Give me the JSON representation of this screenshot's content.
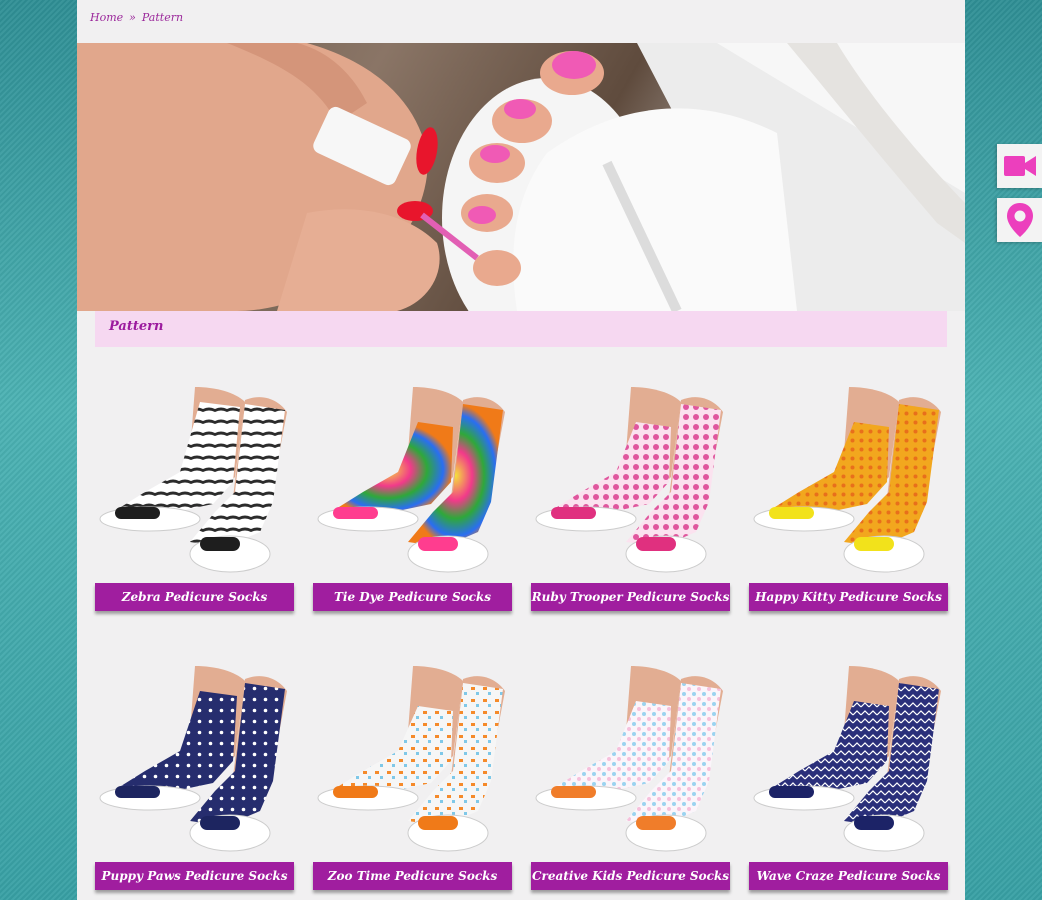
{
  "breadcrumb": {
    "home": "Home",
    "separator": "»",
    "current": "Pattern"
  },
  "section": {
    "title": "Pattern"
  },
  "products": [
    {
      "name": "Zebra Pedicure Socks",
      "color1": "#2b2b2b",
      "color2": "#ffffff",
      "toe": "#1e1e1e"
    },
    {
      "name": "Tie Dye Pedicure Socks",
      "color1": "#2fa83a",
      "color2": "#f23a8a",
      "toe": "#ff3d8f"
    },
    {
      "name": "Ruby Trooper Pedicure Socks",
      "color1": "#e0569e",
      "color2": "#fbe2ef",
      "toe": "#e0307f"
    },
    {
      "name": "Happy Kitty Pedicure Socks",
      "color1": "#f2a71e",
      "color2": "#e86f1b",
      "toe": "#f2e21b"
    },
    {
      "name": "Puppy Paws Pedicure Socks",
      "color1": "#262d6e",
      "color2": "#ffffff",
      "toe": "#1d2560"
    },
    {
      "name": "Zoo Time Pedicure Socks",
      "color1": "#f58a2a",
      "color2": "#f6f6f6",
      "toe": "#f07a18"
    },
    {
      "name": "Creative Kids Pedicure Socks",
      "color1": "#9bd3f0",
      "color2": "#f6c0dc",
      "toe": "#f07d2a"
    },
    {
      "name": "Wave Craze Pedicure Socks",
      "color1": "#2a2f7a",
      "color2": "#ffffff",
      "toe": "#1c2367"
    }
  ],
  "side_buttons": [
    {
      "icon": "video-camera-icon"
    },
    {
      "icon": "map-pin-icon"
    }
  ],
  "colors": {
    "accent": "#a01e9f",
    "section_bg": "#f6d8f1",
    "icon": "#ec3fbd"
  }
}
